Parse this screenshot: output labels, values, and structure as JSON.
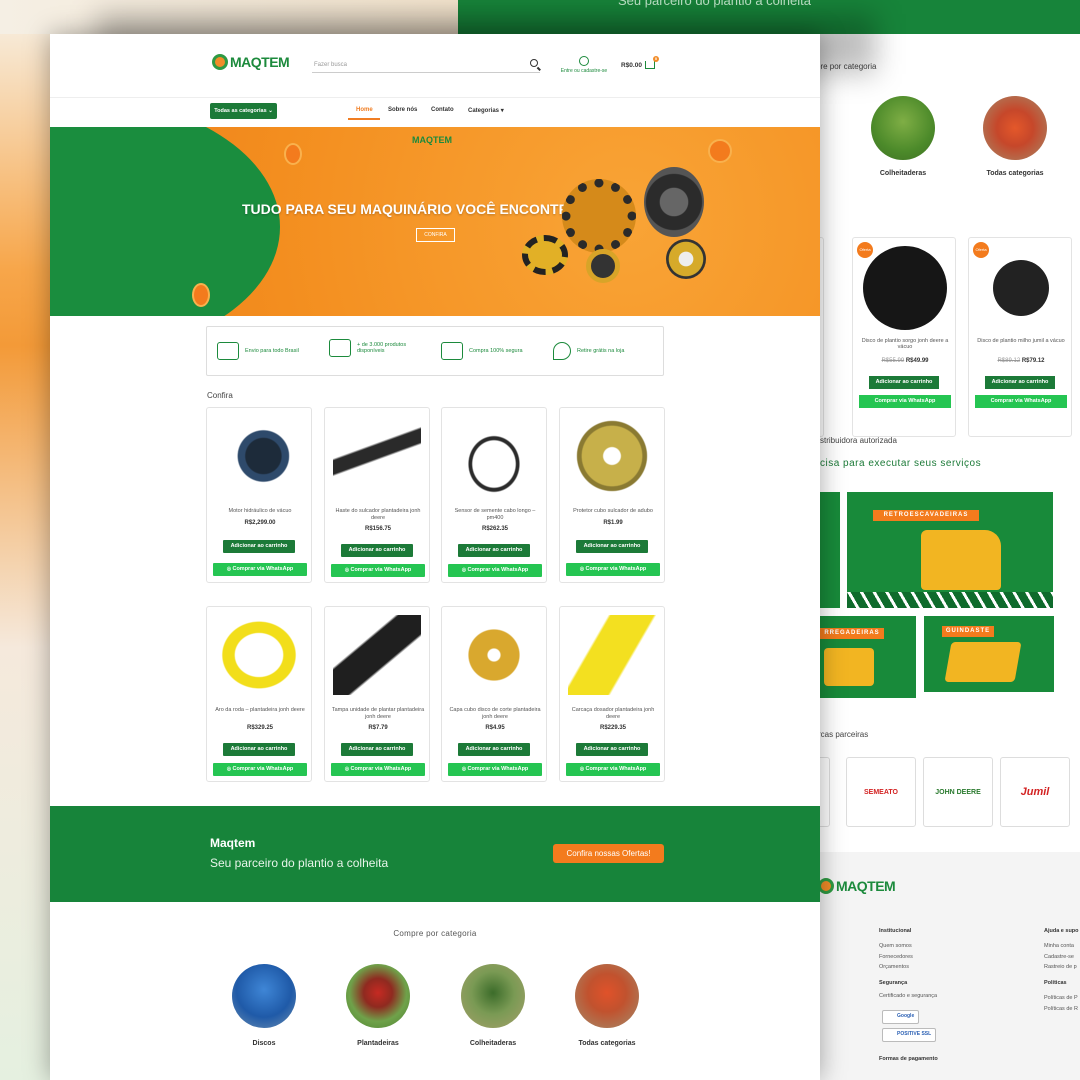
{
  "header": {
    "logo_text": "MAQTEM",
    "search_placeholder": "Fazer busca",
    "account_label": "Entre ou cadastre-se",
    "cart_total": "R$0.00",
    "cart_count": "0",
    "all_categories_label": "Todas as categorias",
    "nav": [
      "Home",
      "Sobre nós",
      "Contato",
      "Categorias"
    ]
  },
  "hero": {
    "logo_text": "MAQTEM",
    "title": "TUDO PARA SEU MAQUINÁRIO VOCÊ ENCONTRA AQUI!",
    "button": "CONFIRA"
  },
  "features": [
    "Envio para todo Brasil",
    "+ de 3.000 produtos disponíveis",
    "Compra 100% segura",
    "Retire grátis na loja"
  ],
  "products_section": {
    "title": "Confira",
    "add_label": "Adicionar ao carrinho",
    "whatsapp_label": "Comprar via WhatsApp",
    "products": [
      {
        "name": "Motor hidráulico de vácuo",
        "price": "R$2,299.00"
      },
      {
        "name": "Haste do sulcador plantadeira jonh deere",
        "price": "R$156.75"
      },
      {
        "name": "Sensor de semente cabo longo – pm400",
        "price": "R$262.35"
      },
      {
        "name": "Protetor cubo sulcador de adubo",
        "price": "R$1.99"
      },
      {
        "name": "Aro da roda – plantadeira jonh deere",
        "price": "R$329.25"
      },
      {
        "name": "Tampa unidade de plantar plantadeira jonh deere",
        "price": "R$7.79"
      },
      {
        "name": "Capa cubo disco de corte plantadeira jonh deere",
        "price": "R$4.95"
      },
      {
        "name": "Carcaça dosador plantadeira jonh deere",
        "price": "R$229.35"
      }
    ]
  },
  "band": {
    "title": "Maqtem",
    "subtitle": "Seu parceiro do plantio a colheita",
    "button": "Confira nossas Ofertas!"
  },
  "categories": {
    "title": "Compre por categoria",
    "items": [
      "Discos",
      "Plantadeiras",
      "Colheitaderas",
      "Todas categorias"
    ]
  },
  "background_page": {
    "top_band_text": "Seu parceiro do plantio a colheita",
    "categories_title": "ore por categoria",
    "categories": [
      "Colheitaderas",
      "Todas categorias"
    ],
    "offer_badge": "Oferta",
    "offers": [
      {
        "name": "Disco de plantio sorgo jonh deere a vácuo",
        "old_price": "R$55.99",
        "price": "R$49.99"
      },
      {
        "name": "Disco de plantio milho jumil a vácuo",
        "old_price": "R$89.12",
        "price": "R$79.12"
      }
    ],
    "distributor_text": "stribuidora autorizada",
    "services_text": "cisa para executar seus serviços",
    "banners": [
      "RETROESCAVADEIRAS",
      "RREGADEIRAS",
      "GUINDASTE"
    ],
    "partners_title": "rcas parceiras",
    "brands": [
      "SEMEATO",
      "JOHN DEERE",
      "Jumil"
    ],
    "footer": {
      "col1_title": "Institucional",
      "col1_links": [
        "Quem somos",
        "Fornecedores",
        "Orçamentos"
      ],
      "col2_title": "Ajuda e supo",
      "col2_links": [
        "Minha conta",
        "Cadastre-se",
        "Rastreio de p"
      ],
      "security_title": "Segurança",
      "security_text": "Certificado e segurança",
      "seals": [
        "Google",
        "POSITIVE SSL"
      ],
      "policies_title": "Políticas",
      "policies_links": [
        "Políticas de P",
        "Políticas de R"
      ],
      "payment_title": "Formas de pagamento"
    }
  },
  "colors": {
    "green": "#17843a",
    "orange": "#f37b1d",
    "whatsapp": "#25c552"
  }
}
